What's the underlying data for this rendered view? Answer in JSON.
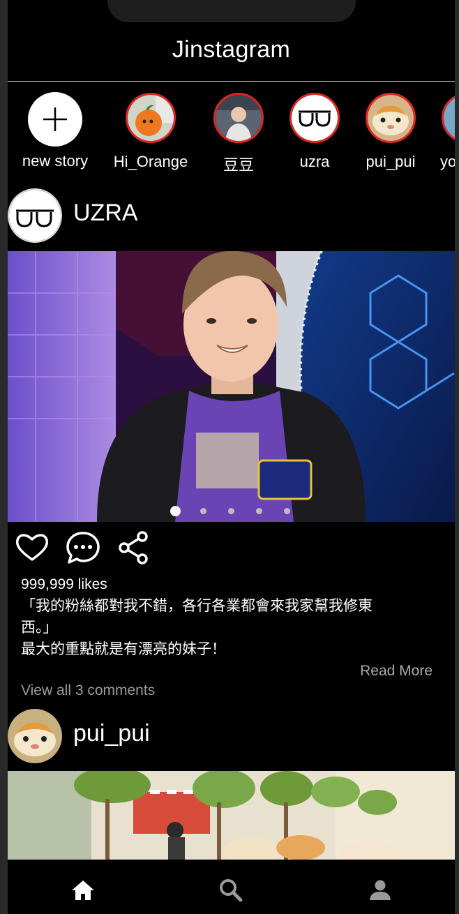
{
  "app": {
    "title": "Jinstagram"
  },
  "stories": [
    {
      "label": "new story",
      "type": "new"
    },
    {
      "label": "Hi_Orange"
    },
    {
      "label": "豆豆"
    },
    {
      "label": "uzra"
    },
    {
      "label": "pui_pui"
    },
    {
      "label": "yo"
    }
  ],
  "posts": [
    {
      "username": "UZRA",
      "likes": "999,999 likes",
      "caption_lines": [
        "「我的粉絲都對我不錯，各行各業都會來我家幫我修東",
        "西。」",
        "最大的重點就是有漂亮的妹子！"
      ],
      "read_more": "Read More",
      "view_comments": "View all 3 comments",
      "carousel_count": 5,
      "carousel_active": 1
    },
    {
      "username": "pui_pui"
    }
  ],
  "tabs": [
    "home-icon",
    "search-icon",
    "profile-icon"
  ],
  "colors": {
    "story_ring": "#e0271f",
    "background": "#000000",
    "text": "#ffffff",
    "muted": "#9a9a9a"
  }
}
